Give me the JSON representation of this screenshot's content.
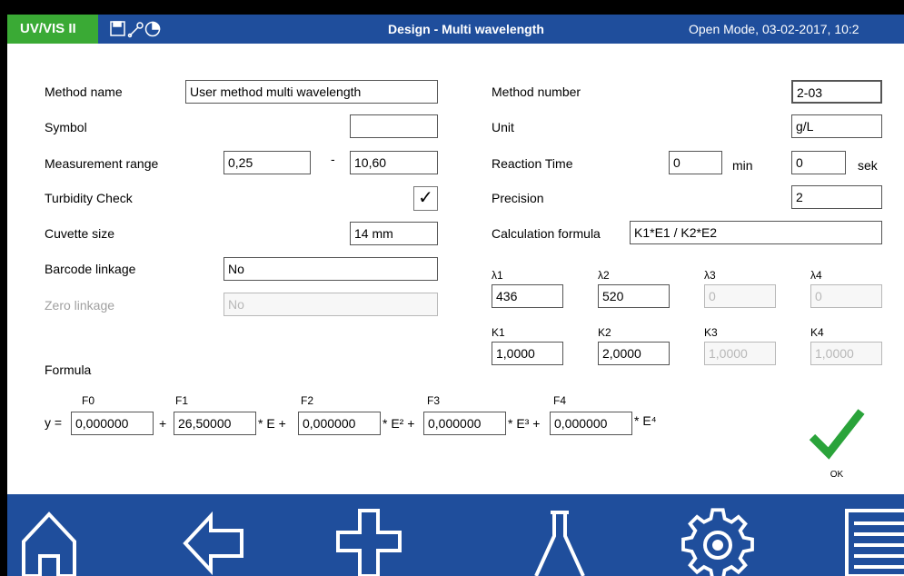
{
  "titlebar": {
    "brand": "UV/VIS II",
    "title": "Design - Multi wavelength",
    "mode_text": "Open Mode, 03-02-2017, 10:2",
    "icons": [
      "save-icon",
      "wrench-icon",
      "timer-icon"
    ]
  },
  "form": {
    "method_name": {
      "label": "Method name",
      "value": "User method multi wavelength"
    },
    "symbol": {
      "label": "Symbol",
      "value": ""
    },
    "measurement_range": {
      "label": "Measurement range",
      "min": "0,25",
      "separator": "-",
      "max": "10,60"
    },
    "turbidity_check": {
      "label": "Turbidity Check",
      "checked": true,
      "mark": "✓"
    },
    "cuvette_size": {
      "label": "Cuvette size",
      "value": "14 mm"
    },
    "barcode_linkage": {
      "label": "Barcode linkage",
      "value": "No"
    },
    "zero_linkage": {
      "label": "Zero linkage",
      "value": "No",
      "disabled": true
    },
    "method_number": {
      "label": "Method number",
      "value": "2-03"
    },
    "unit": {
      "label": "Unit",
      "value": "g/L"
    },
    "reaction_time": {
      "label": "Reaction Time",
      "min_value": "0",
      "min_unit": "min",
      "sec_value": "0",
      "sec_unit": "sek"
    },
    "precision": {
      "label": "Precision",
      "value": "2"
    },
    "calculation_formula": {
      "label": "Calculation formula",
      "value": "K1*E1 / K2*E2"
    }
  },
  "wavelengths": [
    {
      "label": "λ1",
      "value": "436",
      "disabled": false
    },
    {
      "label": "λ2",
      "value": "520",
      "disabled": false
    },
    {
      "label": "λ3",
      "value": "0",
      "disabled": true
    },
    {
      "label": "λ4",
      "value": "0",
      "disabled": true
    }
  ],
  "factors": [
    {
      "label": "K1",
      "value": "1,0000",
      "disabled": false
    },
    {
      "label": "K2",
      "value": "2,0000",
      "disabled": false
    },
    {
      "label": "K3",
      "value": "1,0000",
      "disabled": true
    },
    {
      "label": "K4",
      "value": "1,0000",
      "disabled": true
    }
  ],
  "formula": {
    "title": "Formula",
    "prefix": "y =",
    "coefficients": [
      {
        "label": "F0",
        "value": "0,000000",
        "suffix": "+"
      },
      {
        "label": "F1",
        "value": "26,50000",
        "suffix": "* E +"
      },
      {
        "label": "F2",
        "value": "0,000000",
        "suffix": "* E² +"
      },
      {
        "label": "F3",
        "value": "0,000000",
        "suffix": "* E³ +"
      },
      {
        "label": "F4",
        "value": "0,000000",
        "suffix": "* E⁴"
      }
    ]
  },
  "ok_button": {
    "label": "OK",
    "color": "#2aa33a"
  },
  "navbar": {
    "color": "#1f4e9c",
    "buttons": [
      "home-icon",
      "back-arrow-icon",
      "add-icon",
      "flask-icon",
      "settings-gear-icon",
      "menu-list-icon"
    ]
  }
}
